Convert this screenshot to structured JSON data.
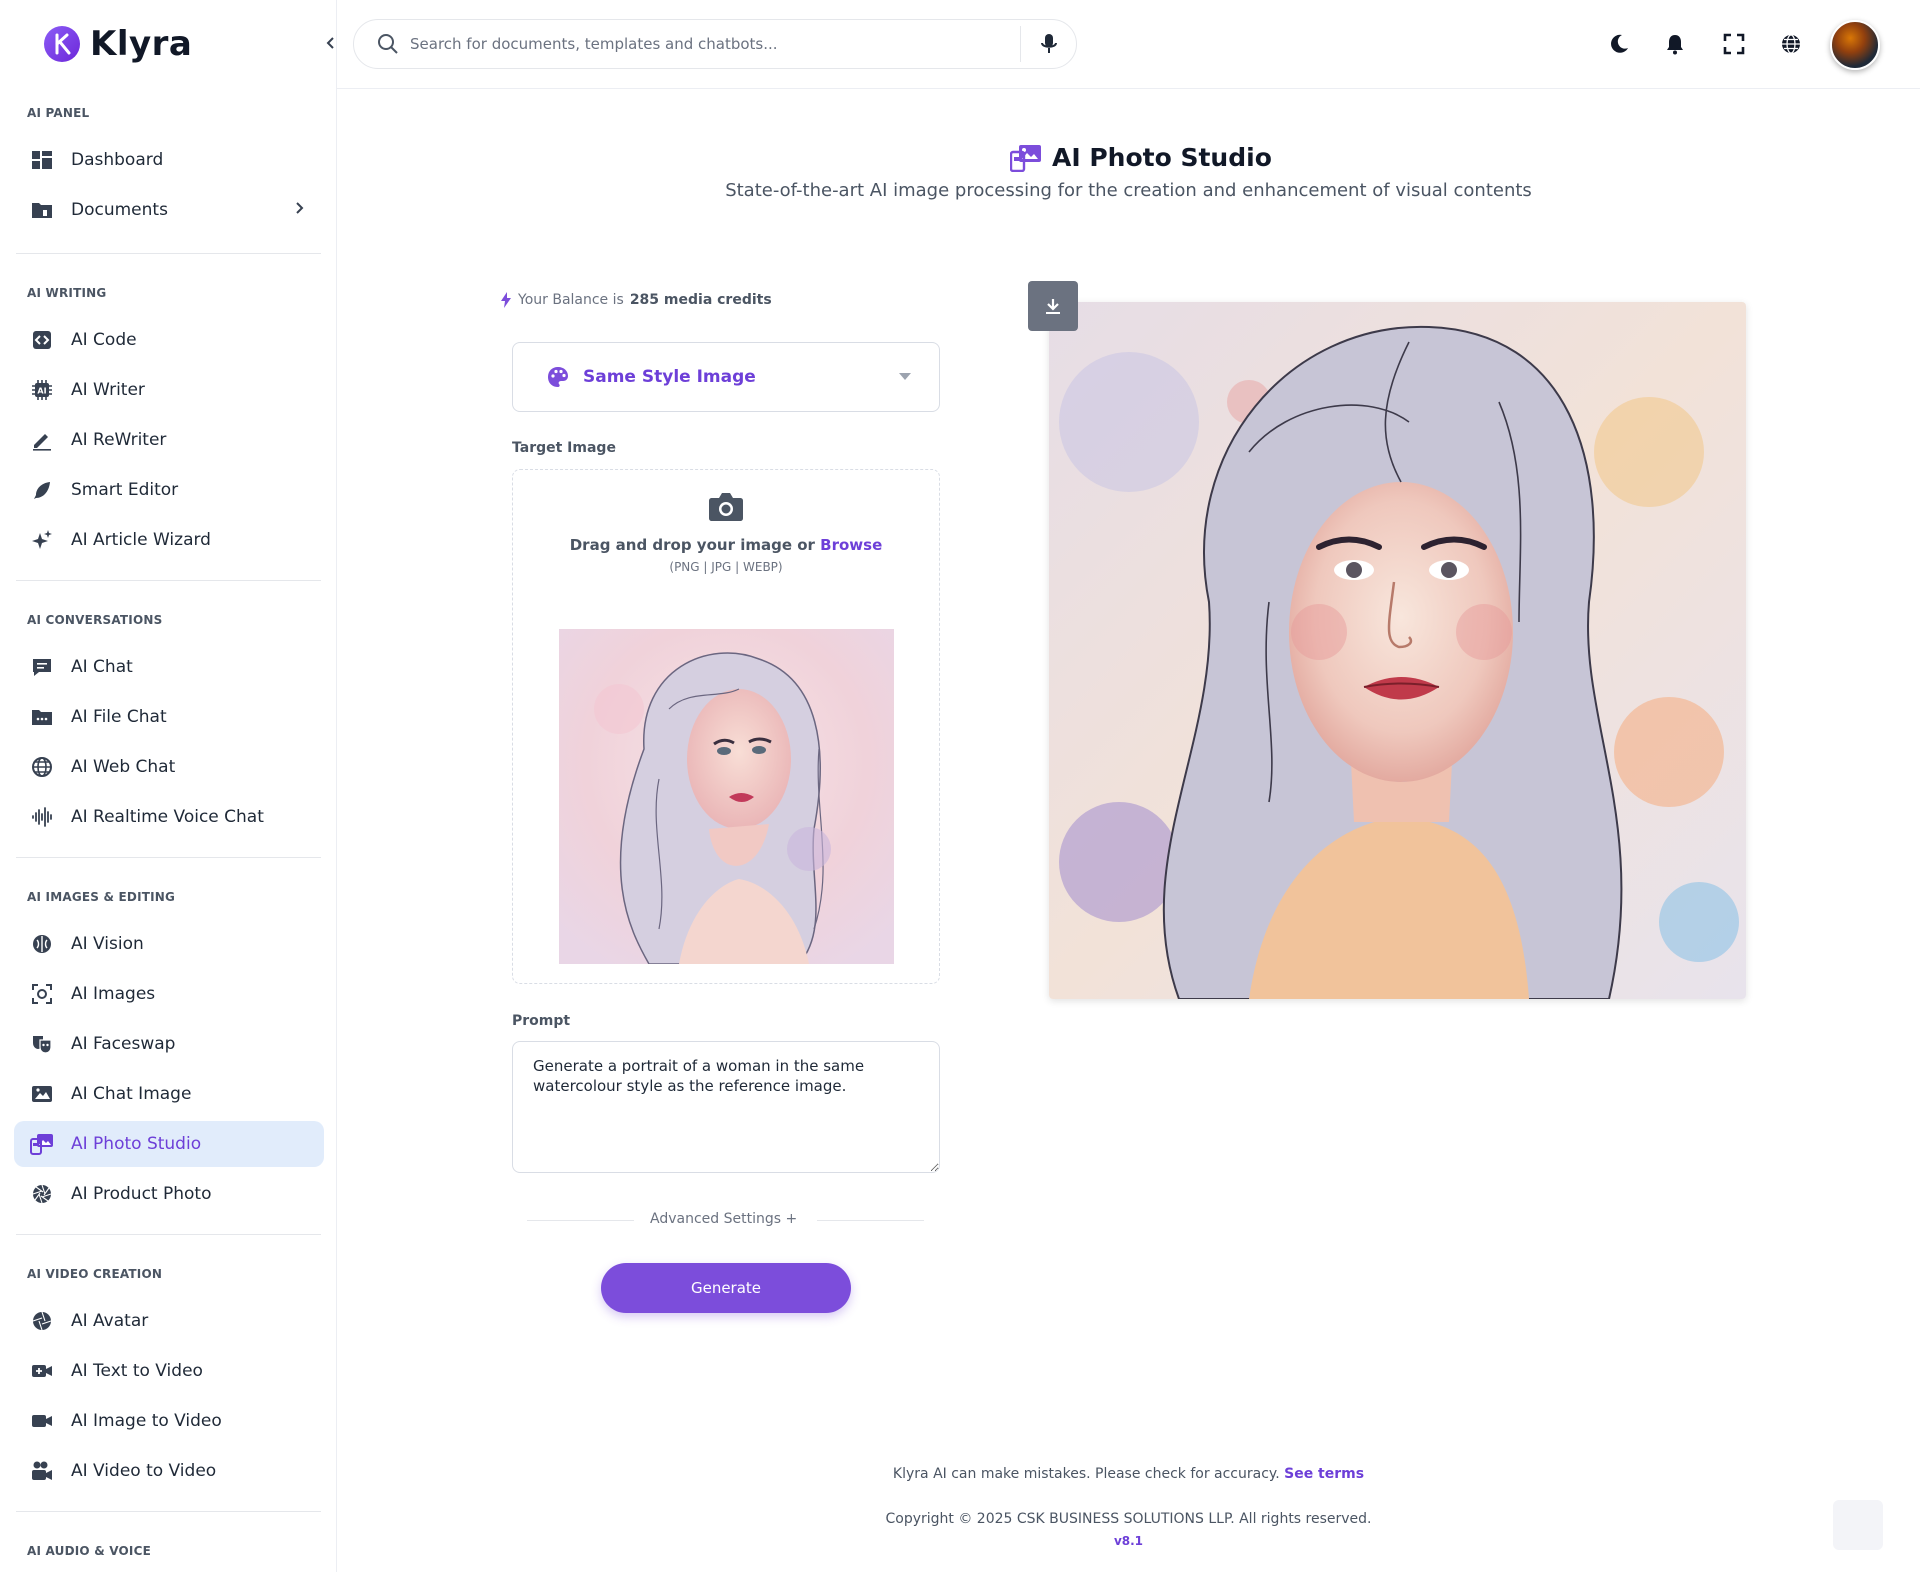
{
  "app": {
    "name": "Klyra"
  },
  "sidebar": {
    "sections": {
      "ai_panel": "AI PANEL",
      "ai_writing": "AI WRITING",
      "ai_conversations": "AI CONVERSATIONS",
      "ai_images": "AI IMAGES & EDITING",
      "ai_video": "AI VIDEO CREATION",
      "ai_audio": "AI AUDIO & VOICE"
    },
    "items": {
      "dashboard": "Dashboard",
      "documents": "Documents",
      "ai_code": "AI Code",
      "ai_writer": "AI Writer",
      "ai_rewriter": "AI ReWriter",
      "smart_editor": "Smart Editor",
      "ai_article_wizard": "AI Article Wizard",
      "ai_chat": "AI Chat",
      "ai_file_chat": "AI File Chat",
      "ai_web_chat": "AI Web Chat",
      "ai_realtime_voice_chat": "AI Realtime Voice Chat",
      "ai_vision": "AI Vision",
      "ai_images": "AI Images",
      "ai_faceswap": "AI Faceswap",
      "ai_chat_image": "AI Chat Image",
      "ai_photo_studio": "AI Photo Studio",
      "ai_product_photo": "AI Product Photo",
      "ai_avatar": "AI Avatar",
      "ai_text_to_video": "AI Text to Video",
      "ai_image_to_video": "AI Image to Video",
      "ai_video_to_video": "AI Video to Video"
    },
    "active": "ai_photo_studio"
  },
  "header": {
    "search_placeholder": "Search for documents, templates and chatbots..."
  },
  "main": {
    "title": "AI Photo Studio",
    "subtitle": "State-of-the-art AI image processing for the creation and enhancement of visual contents",
    "balance_prefix": "Your Balance is",
    "balance_value": "285 media credits",
    "mode_select": "Same Style Image",
    "target_image_label": "Target Image",
    "dropzone_text": "Drag and drop your image or",
    "dropzone_browse": "Browse",
    "dropzone_formats": "(PNG | JPG | WEBP)",
    "prompt_label": "Prompt",
    "prompt_value": "Generate a portrait of a woman in the same watercolour style as the reference image.",
    "advanced_settings": "Advanced Settings +",
    "generate_label": "Generate"
  },
  "footer": {
    "note": "Klyra AI can make mistakes. Please check for accuracy.",
    "terms": "See terms",
    "copyright": "Copyright © 2025 CSK BUSINESS SOLUTIONS LLP. All rights reserved.",
    "version": "v8.1"
  },
  "colors": {
    "accent": "#7c4ddb",
    "active_bg": "#e1ecfb"
  }
}
